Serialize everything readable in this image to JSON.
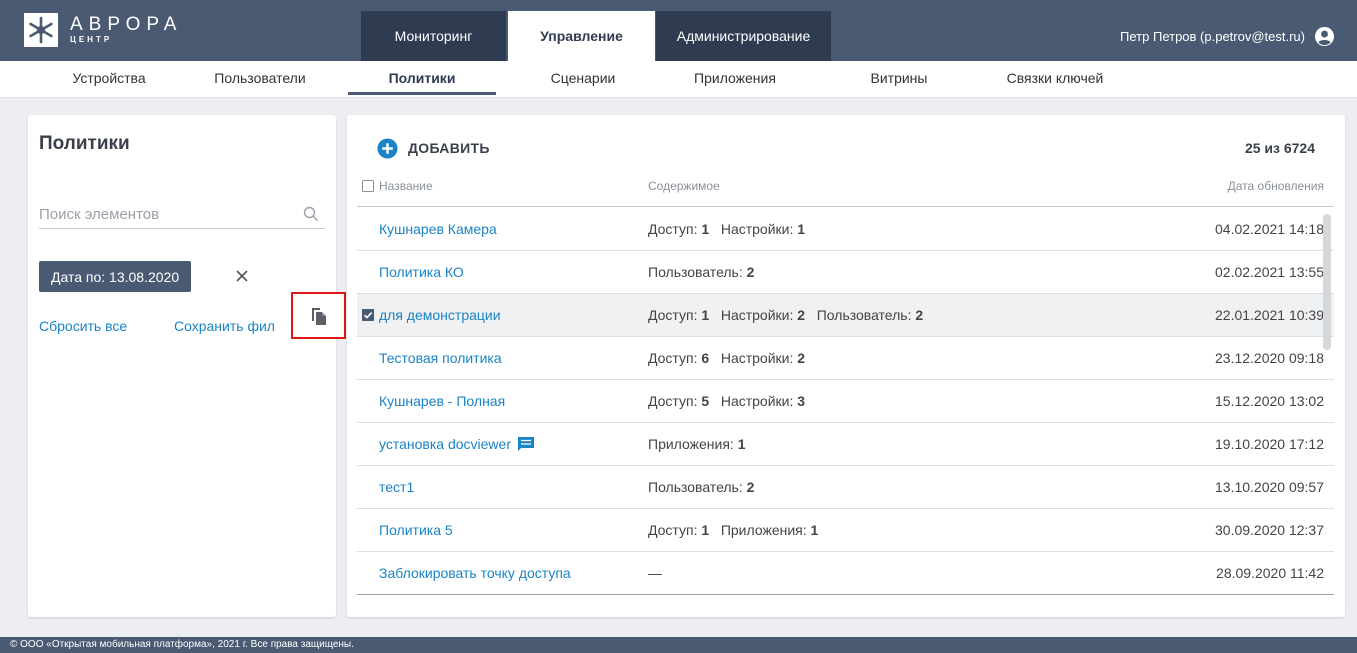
{
  "app": {
    "logo_title": "АВРОРА",
    "logo_subtitle": "ЦЕНТР",
    "user_label": "Петр Петров (p.petrov@test.ru)"
  },
  "topnav": {
    "tabs": [
      {
        "label": "Мониторинг"
      },
      {
        "label": "Управление"
      },
      {
        "label": "Администрирование"
      }
    ]
  },
  "subnav": {
    "items": [
      {
        "label": "Устройства"
      },
      {
        "label": "Пользователи"
      },
      {
        "label": "Политики"
      },
      {
        "label": "Сценарии"
      },
      {
        "label": "Приложения"
      },
      {
        "label": "Витрины"
      },
      {
        "label": "Связки ключей"
      }
    ]
  },
  "sidebar": {
    "title": "Политики",
    "search_placeholder": "Поиск элементов",
    "filter_chip": "Дата по: 13.08.2020",
    "reset_all": "Сбросить все",
    "save_filter": "Сохранить фил"
  },
  "main": {
    "add_label": "ДОБАВИТЬ",
    "count": "25 из 6724",
    "columns": {
      "name": "Название",
      "content": "Содержимое",
      "date": "Дата обновления"
    },
    "rows": [
      {
        "name": "Кушнарев Камера",
        "date": "04.02.2021 14:18"
      },
      {
        "name": "Политика КО",
        "date": "02.02.2021 13:55"
      },
      {
        "name": "для демонстрации",
        "date": "22.01.2021 10:39"
      },
      {
        "name": "Тестовая политика",
        "date": "23.12.2020 09:18"
      },
      {
        "name": "Кушнарев - Полная",
        "date": "15.12.2020 13:02"
      },
      {
        "name": "установка docviewer",
        "date": "19.10.2020 17:12"
      },
      {
        "name": "тест1",
        "date": "13.10.2020 09:57"
      },
      {
        "name": "Политика 5",
        "date": "30.09.2020 12:37"
      },
      {
        "name": "Заблокировать точку доступа",
        "date": "28.09.2020 11:42"
      }
    ],
    "content_labels": {
      "access": "Доступ:",
      "settings": "Настройки:",
      "user": "Пользователь:",
      "apps": "Приложения:",
      "dash": "—"
    },
    "content_values": {
      "r0_access": "1",
      "r0_settings": "1",
      "r1_user": "2",
      "r2_access": "1",
      "r2_settings": "2",
      "r2_user": "2",
      "r3_access": "6",
      "r3_settings": "2",
      "r4_access": "5",
      "r4_settings": "3",
      "r5_apps": "1",
      "r6_user": "2",
      "r7_access": "1",
      "r7_apps": "1"
    }
  },
  "footer": {
    "text": "© ООО «Открытая мобильная платформа», 2021 г. Все права защищены."
  },
  "colors": {
    "header_bg": "#4b5a73",
    "header_dark": "#2f3b51",
    "link": "#1a84c6",
    "highlight_box": "#e01717"
  },
  "icons": [
    "logo-icon",
    "user-account-icon",
    "search-icon",
    "close-icon",
    "copy-icon",
    "add-circle-icon",
    "message-icon",
    "checkbox-icon"
  ]
}
